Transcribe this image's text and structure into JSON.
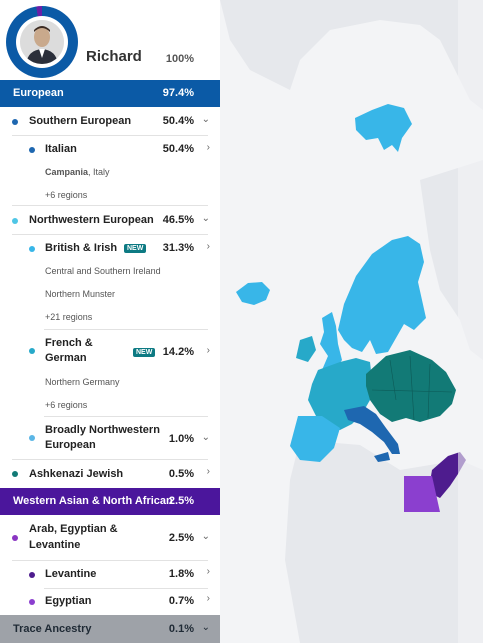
{
  "profile": {
    "name": "Richard",
    "total": "100%"
  },
  "colors": {
    "european": "#0b5aa6",
    "southern": "#1e67b0",
    "italian": "#1e67b0",
    "northwestern": "#4ec6e6",
    "british": "#38b6e8",
    "french": "#27a9c9",
    "broadly": "#5bb6e6",
    "ashkenazi": "#127a76",
    "wana": "#4b169c",
    "arab": "#8a35c2",
    "levantine": "#4e1c8e",
    "egyptian": "#8b3fcf",
    "trace": "#9ea2a8"
  },
  "european": {
    "label": "European",
    "pct": "97.4%"
  },
  "southern": {
    "label": "Southern European",
    "pct": "50.4%"
  },
  "italian": {
    "label": "Italian",
    "pct": "50.4%",
    "region_bold": "Campania",
    "region_rest": ", Italy",
    "more": "+6 regions"
  },
  "northwestern": {
    "label": "Northwestern European",
    "pct": "46.5%"
  },
  "british": {
    "label": "British & Irish",
    "badge": "NEW",
    "pct": "31.3%",
    "regions": [
      "Central and Southern Ireland",
      "Northern Munster"
    ],
    "more": "+21 regions"
  },
  "french": {
    "label_line1": "French &",
    "label_line2": "German",
    "badge": "NEW",
    "pct": "14.2%",
    "regions": [
      "Northern Germany"
    ],
    "more": "+6 regions"
  },
  "broadly": {
    "label_line1": "Broadly Northwestern",
    "label_line2": "European",
    "pct": "1.0%"
  },
  "ashkenazi": {
    "label": "Ashkenazi Jewish",
    "pct": "0.5%"
  },
  "wana": {
    "label": "Western Asian & North African",
    "pct": "2.5%"
  },
  "arab": {
    "label_line1": "Arab, Egyptian &",
    "label_line2": "Levantine",
    "pct": "2.5%"
  },
  "levantine": {
    "label": "Levantine",
    "pct": "1.8%"
  },
  "egyptian": {
    "label": "Egyptian",
    "pct": "0.7%"
  },
  "trace": {
    "label": "Trace Ancestry",
    "pct": "0.1%"
  }
}
